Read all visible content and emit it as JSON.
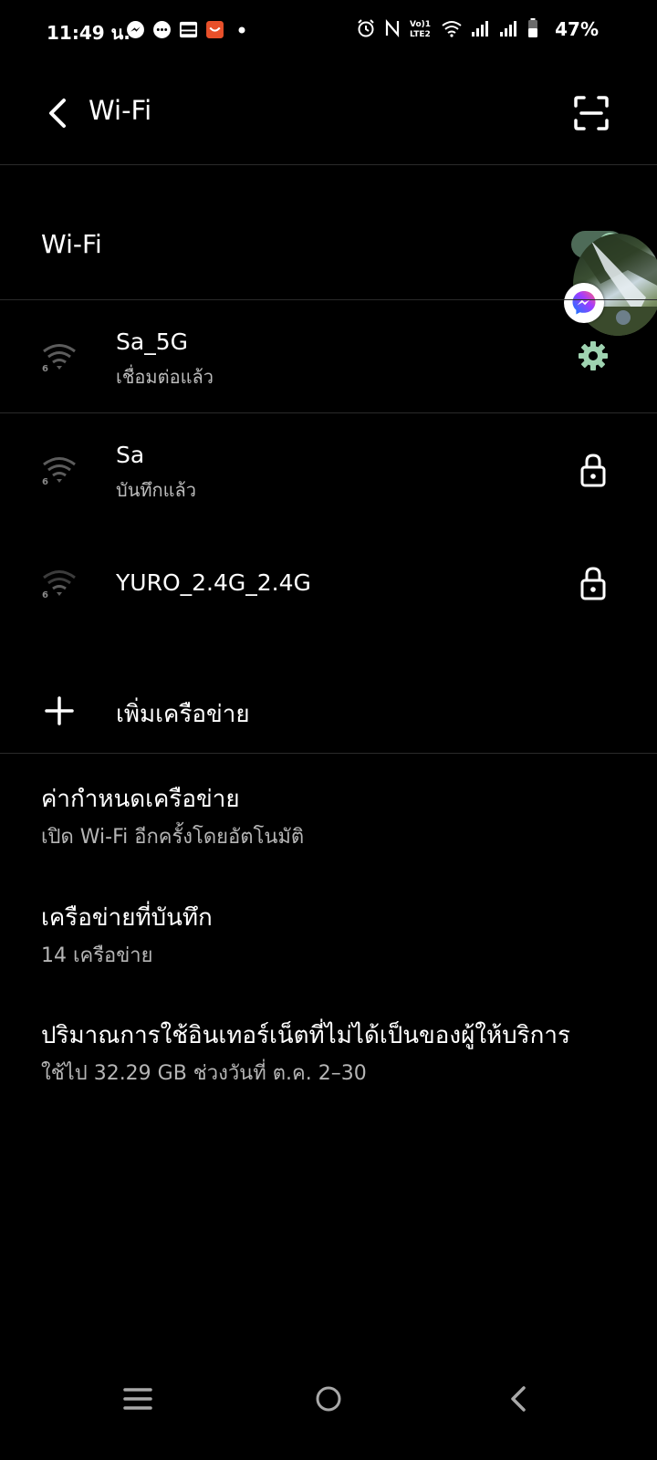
{
  "status_bar": {
    "time": "11:49 น.",
    "battery_percent": "47%",
    "notification_icons": [
      "messenger-icon",
      "chat-bubble-icon",
      "play-games-icon",
      "shopping-app-icon",
      "dot-icon"
    ],
    "system_icons": [
      "alarm-icon",
      "nfc-icon",
      "volte-icon",
      "wifi-icon",
      "signal-icon",
      "signal-icon",
      "battery-icon"
    ],
    "volte_text": "Vo) LTE2"
  },
  "header": {
    "title": "Wi-Fi"
  },
  "wifi_toggle": {
    "label": "Wi-Fi",
    "enabled": true,
    "accent_color": "#9fd3b1"
  },
  "networks": [
    {
      "name": "Sa_5G",
      "status": "เชื่อมต่อแล้ว",
      "wifi_generation": "6",
      "action_icon": "gear-icon"
    },
    {
      "name": "Sa",
      "status": "บันทึกแล้ว",
      "wifi_generation": "6",
      "action_icon": "lock-icon"
    },
    {
      "name": "YURO_2.4G_2.4G",
      "status": "",
      "wifi_generation": "6",
      "action_icon": "lock-icon"
    }
  ],
  "add_network": {
    "label": "เพิ่มเครือข่าย"
  },
  "sections": [
    {
      "title": "ค่ากำหนดเครือข่าย",
      "subtitle": "เปิด Wi-Fi อีกครั้งโดยอัตโนมัติ"
    },
    {
      "title": "เครือข่ายที่บันทึก",
      "subtitle": "14 เครือข่าย"
    },
    {
      "title": "ปริมาณการใช้อินเทอร์เน็ตที่ไม่ได้เป็นของผู้ให้บริการ",
      "subtitle": "ใช้ไป 32.29 GB ช่วงวันที่ ต.ค. 2–30"
    }
  ],
  "nav_bar": {
    "buttons": [
      "recents-icon",
      "home-icon",
      "back-icon"
    ]
  }
}
